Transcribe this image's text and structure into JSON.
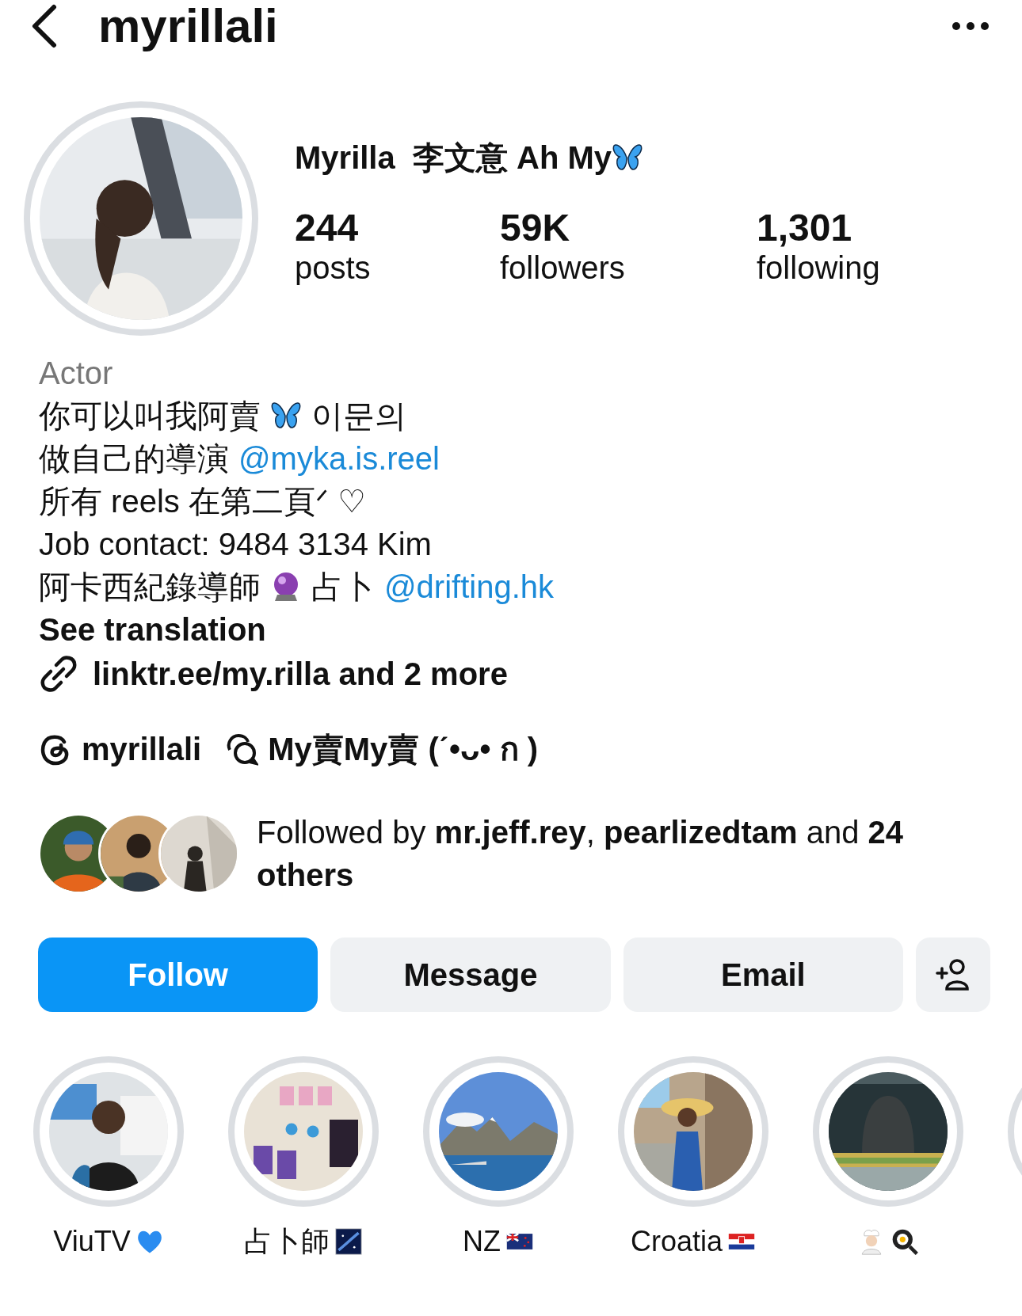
{
  "header": {
    "username": "myrillali"
  },
  "profile": {
    "display_name": "Myrilla  李文意 Ah My",
    "name_icons": [
      {
        "kind": "butterfly"
      }
    ],
    "stats": [
      {
        "value": "244",
        "label": "posts"
      },
      {
        "value": "59K",
        "label": "followers"
      },
      {
        "value": "1,301",
        "label": "following"
      }
    ]
  },
  "bio": {
    "category": "Actor",
    "lines": [
      [
        {
          "kind": "text",
          "text": "你可以叫我阿賣"
        },
        {
          "kind": "butterfly"
        },
        {
          "kind": "text",
          "text": "이문의"
        }
      ],
      [
        {
          "kind": "text",
          "text": "做自己的導演"
        },
        {
          "kind": "mention",
          "text": "@myka.is.reel"
        }
      ],
      [
        {
          "kind": "text",
          "text": "所有 reels 在第二頁ᐟ ♡"
        }
      ],
      [
        {
          "kind": "text",
          "text": "Job contact: 9484 3134 Kim"
        }
      ],
      [
        {
          "kind": "text",
          "text": "阿卡西紀錄導師"
        },
        {
          "kind": "crystal_ball"
        },
        {
          "kind": "text",
          "text": "占卜"
        },
        {
          "kind": "mention",
          "text": "@drifting.hk"
        }
      ]
    ],
    "see_translation": "See translation",
    "link": "linktr.ee/my.rilla and 2 more"
  },
  "threads": {
    "handle": "myrillali",
    "channel": "My賣My賣 (ˊ•ᴗ• ก )"
  },
  "followed_by": {
    "text": "Followed by **mr.jeff.rey**, **pearlizedtam** and **24 others**"
  },
  "buttons": [
    {
      "kind": "primary",
      "label": "Follow"
    },
    {
      "kind": "secondary",
      "label": "Message"
    },
    {
      "kind": "secondary",
      "label": "Email"
    },
    {
      "kind": "add_person"
    }
  ],
  "highlights": [
    {
      "label": "ViuTV",
      "icons": [
        {
          "kind": "blue_heart"
        }
      ]
    },
    {
      "label": "占卜師",
      "icons": [
        {
          "kind": "galaxy"
        }
      ]
    },
    {
      "label": "NZ",
      "icons": [
        {
          "kind": "nz_flag"
        }
      ]
    },
    {
      "label": "Croatia",
      "icons": [
        {
          "kind": "croatia_flag"
        }
      ]
    },
    {
      "icons": [
        {
          "kind": "chef"
        },
        {
          "kind": "frying_pan"
        }
      ]
    }
  ]
}
